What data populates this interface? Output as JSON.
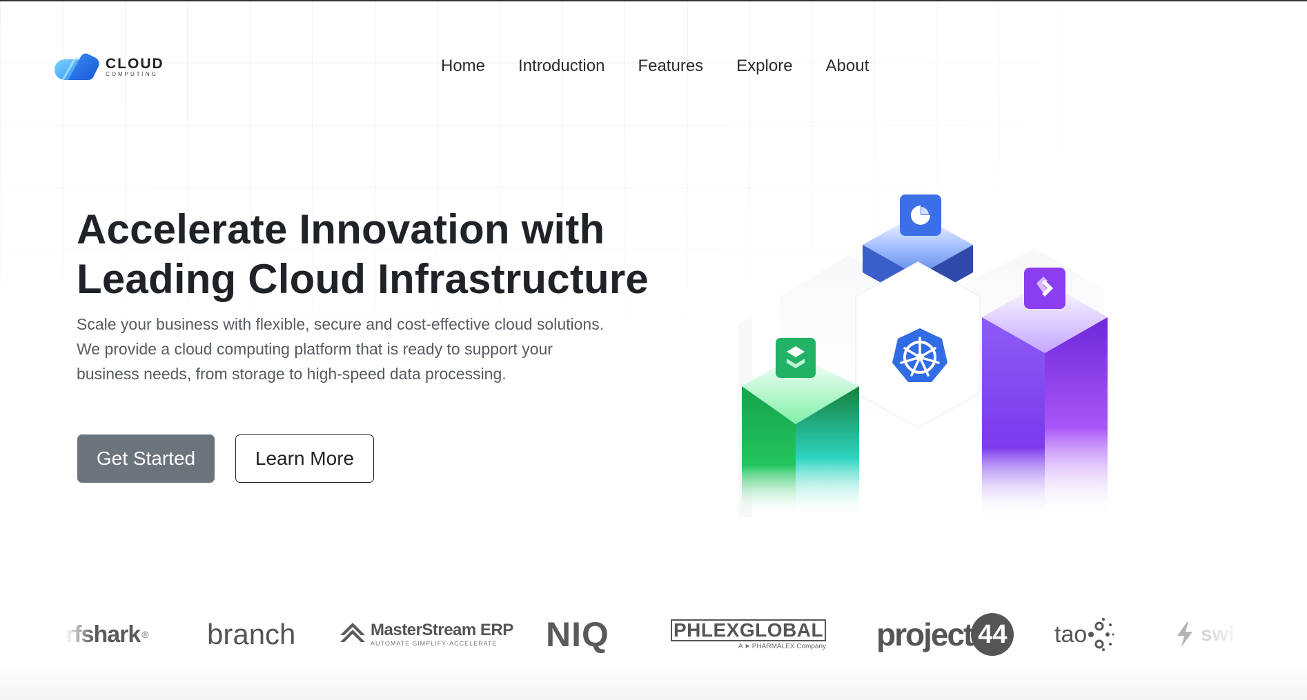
{
  "brand": {
    "name": "CLOUD",
    "tagline": "COMPUTING",
    "accent": "#2f7ff0",
    "accent_light": "#5fc0ff"
  },
  "nav": {
    "items": [
      {
        "label": "Home"
      },
      {
        "label": "Introduction"
      },
      {
        "label": "Features"
      },
      {
        "label": "Explore"
      },
      {
        "label": "About"
      }
    ]
  },
  "hero": {
    "title_line1": "Accelerate Innovation with",
    "title_line2": "Leading Cloud Infrastructure",
    "desc_line1": "Scale your business with flexible, secure and cost-effective cloud solutions.",
    "desc_line2": "We provide a cloud computing platform that is ready to support your",
    "desc_line3": "business needs, from storage to high-speed data processing.",
    "primary_button": "Get Started",
    "secondary_button": "Learn More",
    "primary_color": "#6b737c"
  },
  "illustration": {
    "icons": [
      "pie-chart-icon",
      "double-chevron-icon",
      "layers-icon",
      "kubernetes-helm-icon"
    ],
    "colors": {
      "blue": "#3b6fd8",
      "purple": "#7c3aed",
      "green": "#22c55e",
      "k8s": "#326ce5"
    }
  },
  "partners": {
    "logos": [
      {
        "text": "rfshark",
        "mark": "®"
      },
      {
        "text": "branch"
      },
      {
        "text": "MasterStream ERP",
        "sub": "AUTOMATE·SIMPLIFY·ACCELERATE"
      },
      {
        "text": "NIQ"
      },
      {
        "text": "PHLEXGLOBAL",
        "sub": "A ➤ PHARMALEX Company"
      },
      {
        "text": "project",
        "badge": "44"
      },
      {
        "text": "tao"
      },
      {
        "text": "swi"
      }
    ]
  }
}
